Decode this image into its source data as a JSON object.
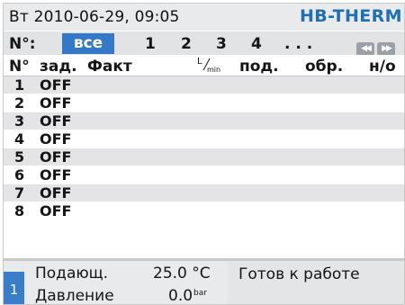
{
  "header": {
    "title": "Вт 2010-06-29, 09:05",
    "brand": "HB-THERM"
  },
  "tabbar": {
    "label": "N°:",
    "tabs": [
      {
        "label": "все",
        "active": true
      },
      {
        "label": "1"
      },
      {
        "label": "2"
      },
      {
        "label": "3"
      },
      {
        "label": "4"
      },
      {
        "label": ". . ."
      }
    ],
    "nav": {
      "prev_icon": "double-left-arrow-icon",
      "next_icon": "double-right-arrow-icon"
    },
    "active_color": "#3478c8"
  },
  "table": {
    "columns": {
      "num": "N°",
      "setpoint": "зад.",
      "actual": "Факт",
      "flow_unit_top": "L",
      "flow_unit_bottom": "min",
      "supply": "под.",
      "return": "обр.",
      "status": "н/о"
    },
    "rows": [
      {
        "num": "1",
        "value": "OFF"
      },
      {
        "num": "2",
        "value": "OFF"
      },
      {
        "num": "3",
        "value": "OFF"
      },
      {
        "num": "4",
        "value": "OFF"
      },
      {
        "num": "5",
        "value": "OFF"
      },
      {
        "num": "6",
        "value": "OFF"
      },
      {
        "num": "7",
        "value": "OFF"
      },
      {
        "num": "8",
        "value": "OFF"
      }
    ]
  },
  "footer": {
    "unit_number": "1",
    "line1_label": "Подающ.",
    "line1_value": "25.0 °C",
    "line2_label": "Давление",
    "line2_value": "0.0",
    "line2_unit": "bar",
    "status": "Готов к работе"
  }
}
